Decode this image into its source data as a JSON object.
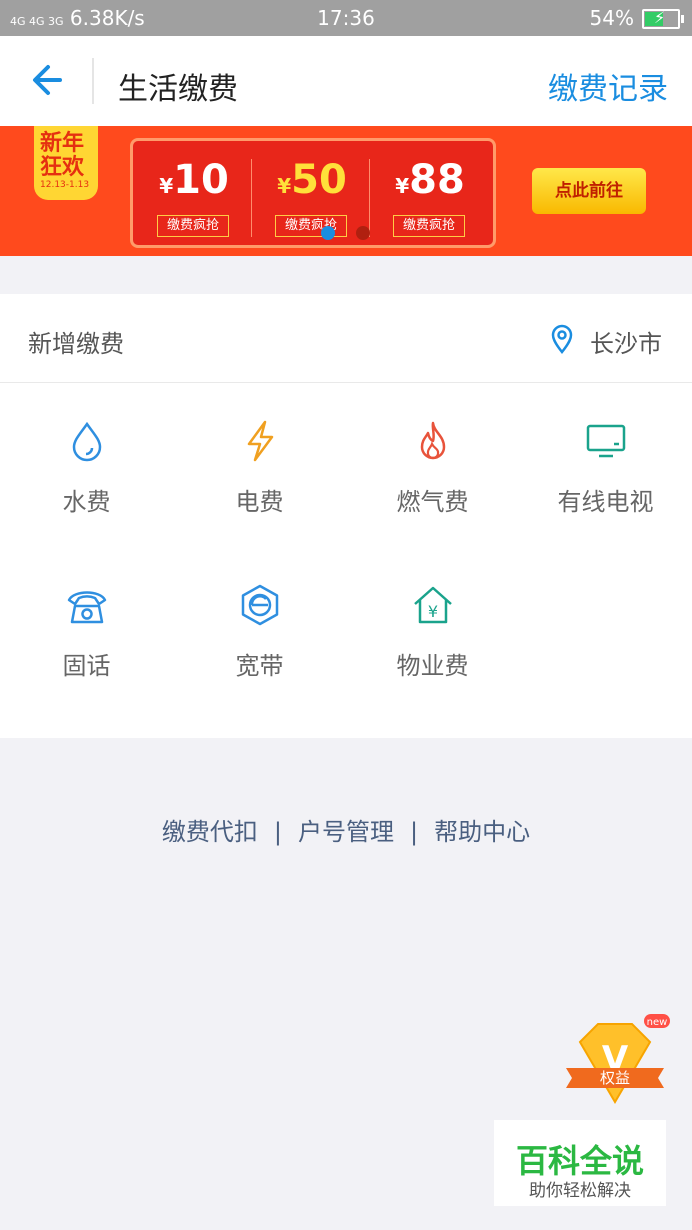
{
  "status_bar": {
    "signal": "4G 4G 3G",
    "speed": "6.38K/s",
    "time": "17:36",
    "battery": "54%"
  },
  "header": {
    "title": "生活缴费",
    "record_link": "缴费记录"
  },
  "banner": {
    "tag_line1": "新年",
    "tag_line2": "狂欢",
    "tag_date": "12.13-1.13",
    "currency": "¥",
    "coupons": [
      {
        "amount": "10",
        "label": "缴费疯抢"
      },
      {
        "amount": "50",
        "label": "缴费疯抢"
      },
      {
        "amount": "88",
        "label": "缴费疯抢"
      }
    ],
    "go_button": "点此前往"
  },
  "section": {
    "title": "新增缴费",
    "city": "长沙市"
  },
  "services": [
    {
      "label": "水费",
      "icon": "water-drop-icon",
      "color": "#2f8fe0"
    },
    {
      "label": "电费",
      "icon": "lightning-icon",
      "color": "#f0a020"
    },
    {
      "label": "燃气费",
      "icon": "flame-icon",
      "color": "#e8533b"
    },
    {
      "label": "有线电视",
      "icon": "tv-icon",
      "color": "#1aa38c"
    },
    {
      "label": "固话",
      "icon": "telephone-icon",
      "color": "#2f8fe0"
    },
    {
      "label": "宽带",
      "icon": "broadband-icon",
      "color": "#2f8fe0"
    },
    {
      "label": "物业费",
      "icon": "property-house-icon",
      "color": "#1aa38c"
    }
  ],
  "footer_links": [
    "缴费代扣",
    "户号管理",
    "帮助中心"
  ],
  "benefit_badge": {
    "letter": "V",
    "label": "权益",
    "new_tag": "new"
  },
  "watermark": {
    "title": "百科全说",
    "subtitle": "助你轻松解决"
  }
}
